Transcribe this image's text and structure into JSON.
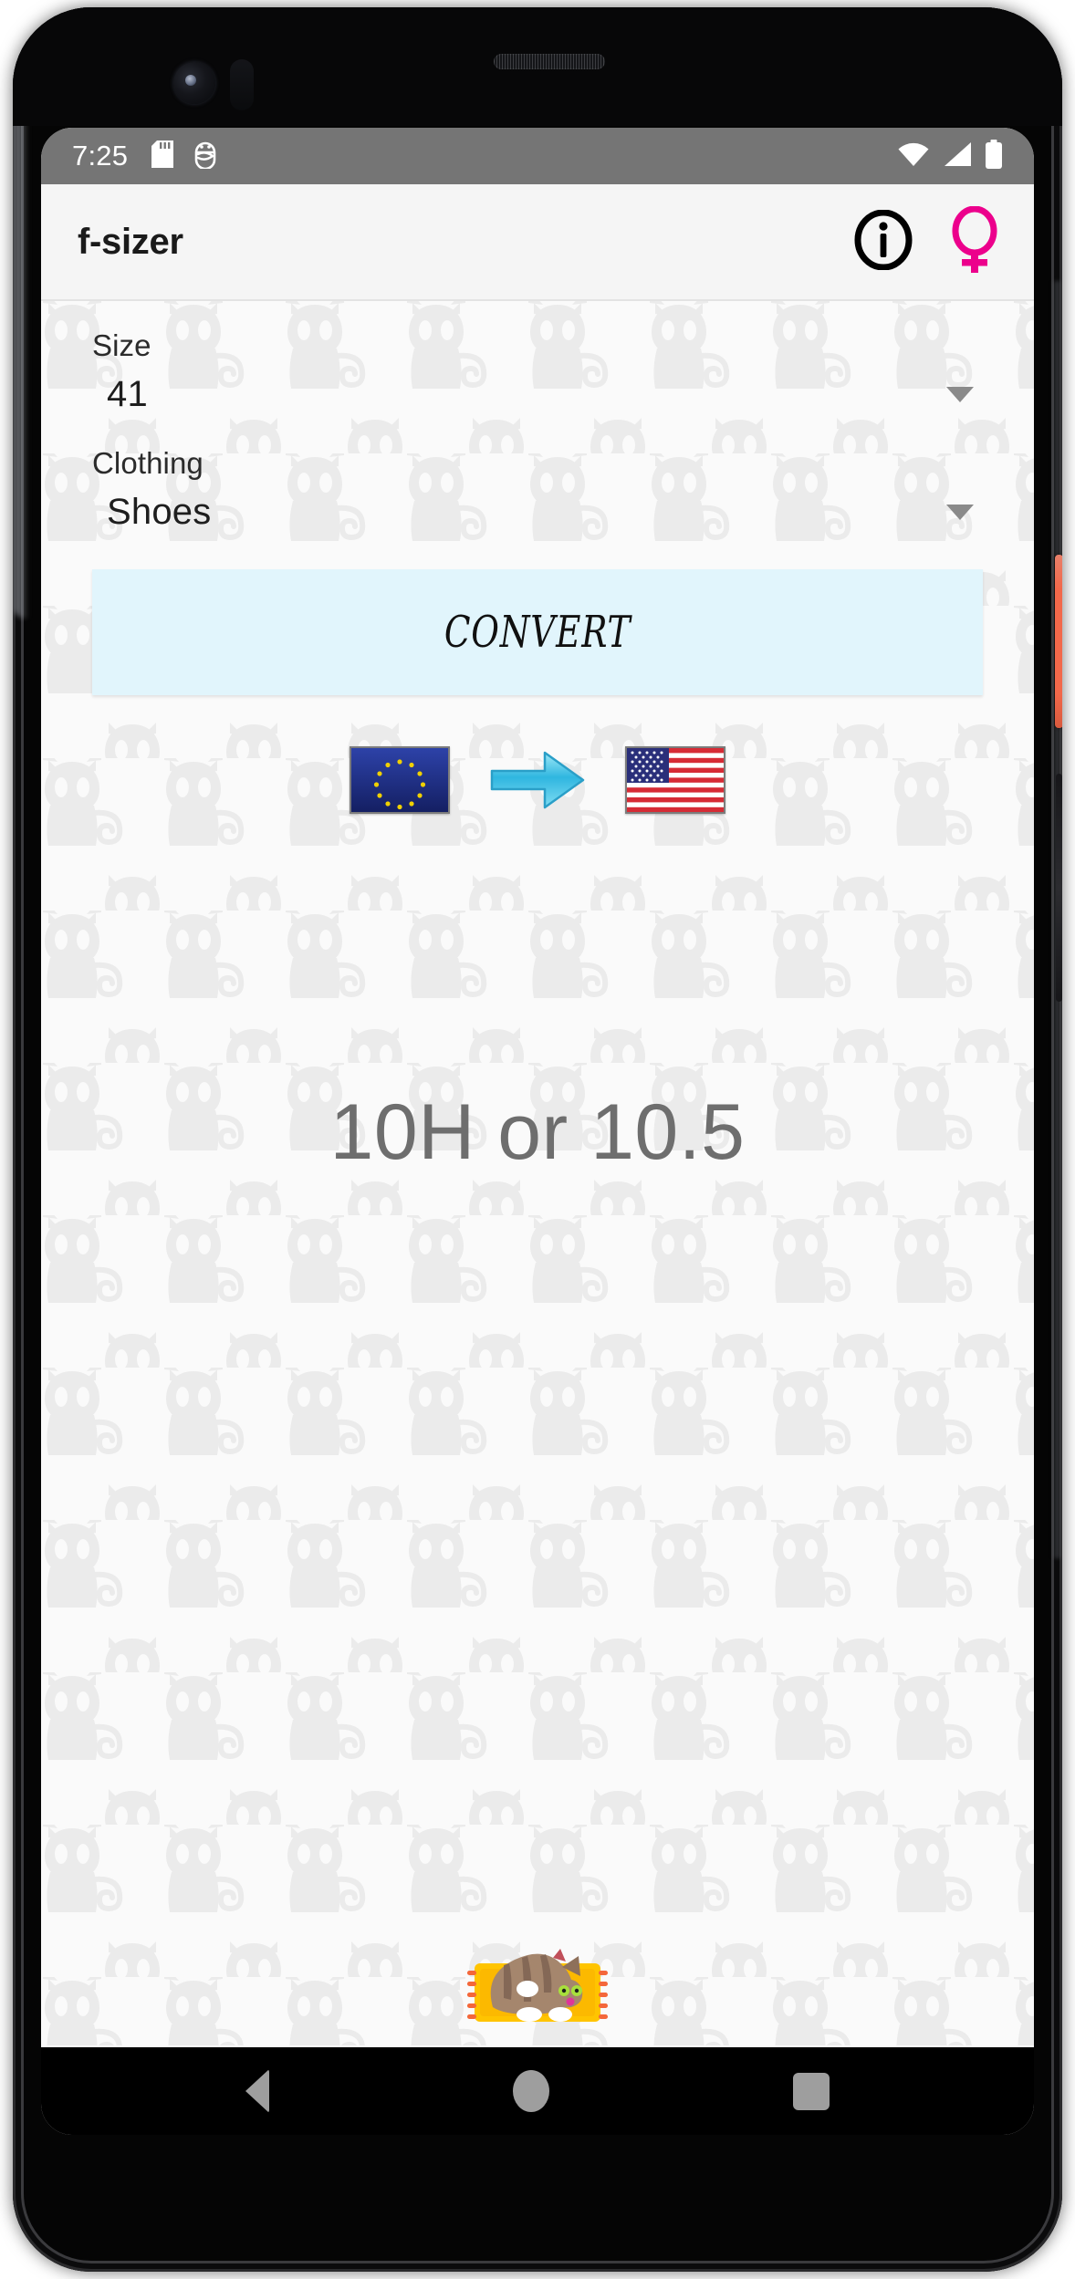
{
  "status_bar": {
    "time": "7:25",
    "left_icons": [
      "sd-card-icon",
      "android-debug-icon"
    ],
    "right_icons": [
      "wifi-icon",
      "cellular-signal-icon",
      "battery-full-icon"
    ],
    "background_color": "#757575"
  },
  "app_bar": {
    "title": "f-sizer",
    "info_icon": "info-circle-icon",
    "gender_icon": "female-venus-icon",
    "gender_icon_color": "#ec008c"
  },
  "form": {
    "size": {
      "label": "Size",
      "value": "41",
      "caret_icon": "chevron-down-icon"
    },
    "clothing": {
      "label": "Clothing",
      "value": "Shoes",
      "caret_icon": "chevron-down-icon"
    }
  },
  "convert_button": {
    "label": "CONVERT",
    "background_color": "#e1f5fc"
  },
  "conversion": {
    "from_flag": "eu-flag-icon",
    "arrow": "right-arrow-icon",
    "to_flag": "us-flag-icon",
    "result": "10H or 10.5",
    "result_color": "#6e6e6e"
  },
  "decoration": {
    "background_watermark": "cat-silhouette-pattern",
    "bottom_image": "sleeping-cat-on-cushion-image"
  },
  "nav_bar": {
    "back": "back-triangle-icon",
    "home": "home-circle-icon",
    "recents": "recents-square-icon"
  }
}
